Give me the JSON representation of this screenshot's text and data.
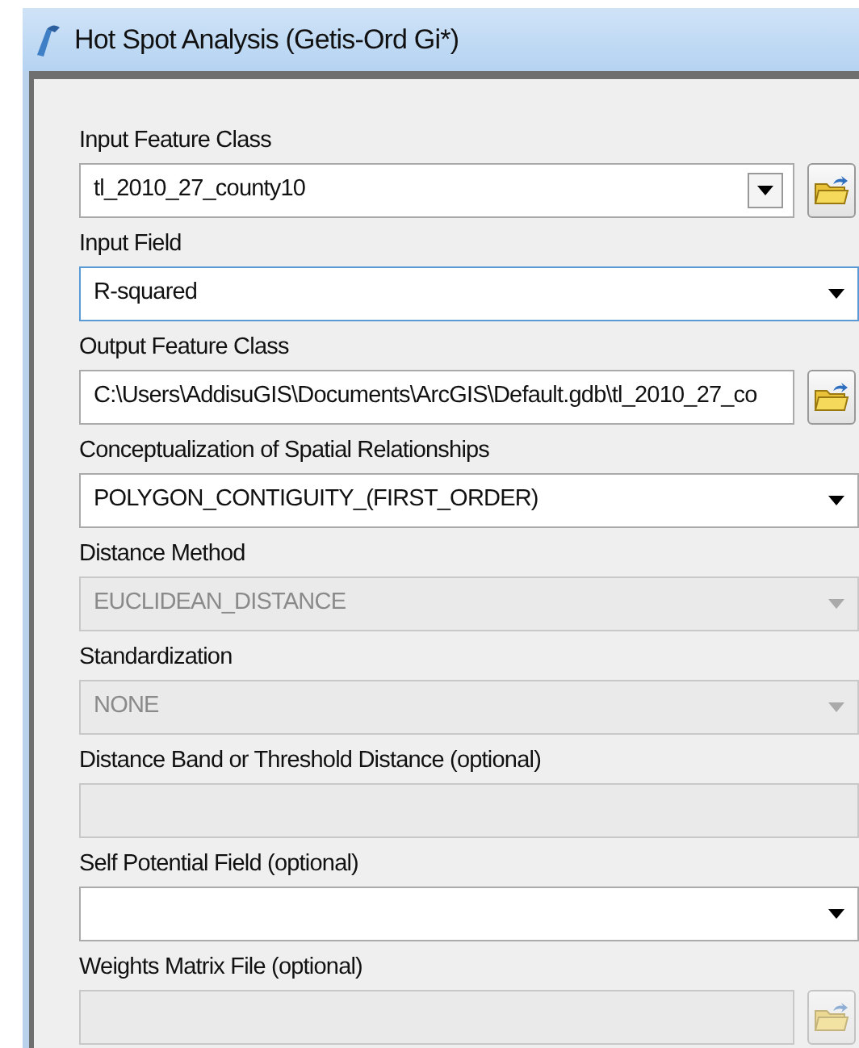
{
  "window": {
    "title": "Hot Spot Analysis (Getis-Ord Gi*)"
  },
  "parameters": [
    {
      "label": "Input Feature Class",
      "kind": "combo",
      "value": "tl_2010_27_county10",
      "disabled": false,
      "focused": false,
      "browse": true
    },
    {
      "label": "Input Field",
      "kind": "dropdown",
      "value": "R-squared",
      "disabled": false,
      "focused": true,
      "browse": false
    },
    {
      "label": "Output Feature Class",
      "kind": "text",
      "value": "C:\\Users\\AddisuGIS\\Documents\\ArcGIS\\Default.gdb\\tl_2010_27_co",
      "disabled": false,
      "focused": false,
      "browse": true
    },
    {
      "label": "Conceptualization of Spatial Relationships",
      "kind": "dropdown",
      "value": "POLYGON_CONTIGUITY_(FIRST_ORDER)",
      "disabled": false,
      "focused": false,
      "browse": false
    },
    {
      "label": "Distance Method",
      "kind": "dropdown",
      "value": "EUCLIDEAN_DISTANCE",
      "disabled": true,
      "focused": false,
      "browse": false
    },
    {
      "label": "Standardization",
      "kind": "dropdown",
      "value": "NONE",
      "disabled": true,
      "focused": false,
      "browse": false
    },
    {
      "label": "Distance Band or Threshold Distance (optional)",
      "kind": "text",
      "disabled": true,
      "focused": false,
      "browse": false
    },
    {
      "label": "Self Potential Field (optional)",
      "kind": "dropdown",
      "disabled": false,
      "focused": false,
      "browse": false
    },
    {
      "label": "Weights Matrix File (optional)",
      "kind": "text",
      "disabled": true,
      "focused": false,
      "browse": true
    }
  ]
}
